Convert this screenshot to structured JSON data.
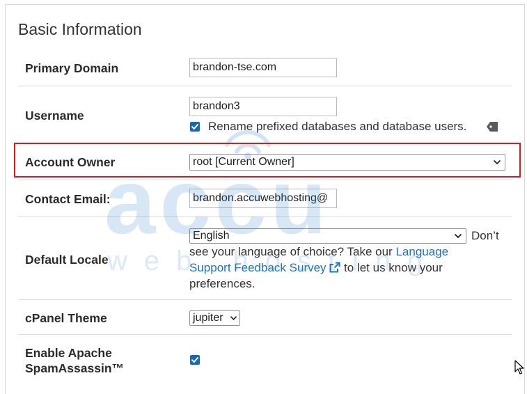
{
  "section": {
    "title": "Basic Information"
  },
  "fields": {
    "primary_domain": {
      "label": "Primary Domain",
      "value": "brandon-tse.com"
    },
    "username": {
      "label": "Username",
      "value": "brandon3",
      "rename_checkbox_label": "Rename prefixed databases and database users.",
      "rename_checked": true
    },
    "account_owner": {
      "label": "Account Owner",
      "selected": "root [Current Owner]"
    },
    "contact_email": {
      "label": "Contact Email:",
      "value": "brandon.accuwebhosting@"
    },
    "default_locale": {
      "label": "Default Locale",
      "selected": "English",
      "help_text_1": "Don’t",
      "help_text_2": "see your language of choice? Take our",
      "link_text_1": "Language",
      "link_text_2": "Support Feedback Survey",
      "help_text_3": "to let us know your",
      "help_text_4": "preferences."
    },
    "cpanel_theme": {
      "label": "cPanel Theme",
      "selected": "jupiter"
    },
    "spamassassin": {
      "label_line1": "Enable Apache",
      "label_line2": "SpamAssassin™",
      "checked": true
    }
  },
  "watermark": {
    "text_main": "accu",
    "text_sub": "web hosting"
  },
  "colors": {
    "highlight": "#e0181b",
    "checkbox": "#1668b8",
    "link": "#1a73c4",
    "divider": "#dcdcdc"
  }
}
